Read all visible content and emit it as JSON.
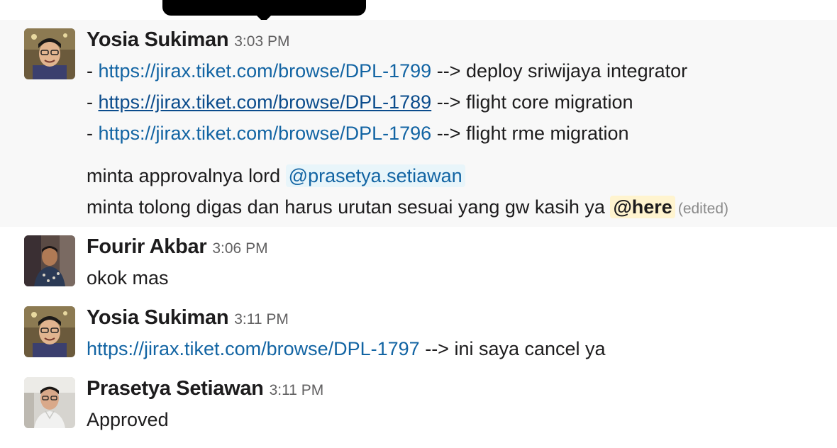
{
  "messages": [
    {
      "author": "Yosia Sukiman",
      "time": "3:03 PM",
      "lines": [
        {
          "prefix": "- ",
          "link": "https://jirax.tiket.com/browse/DPL-1799",
          "suffix": " --> deploy sriwijaya integrator"
        },
        {
          "prefix": "- ",
          "link": "https://jirax.tiket.com/browse/DPL-1789",
          "suffix": " --> flight core migration"
        },
        {
          "prefix": "- ",
          "link": "https://jirax.tiket.com/browse/DPL-1796",
          "suffix": " --> flight rme migration"
        }
      ],
      "approval_text": "minta approvalnya lord ",
      "approval_mention": "@prasetya.setiawan",
      "urge_text": "minta tolong digas dan harus urutan sesuai yang gw kasih ya ",
      "here_mention": "@here",
      "edited_label": "(edited)"
    },
    {
      "author": "Fourir Akbar",
      "time": "3:06 PM",
      "text": "okok mas"
    },
    {
      "author": "Yosia Sukiman",
      "time": "3:11 PM",
      "link": "https://jirax.tiket.com/browse/DPL-1797",
      "suffix": " --> ini saya cancel ya"
    },
    {
      "author": "Prasetya Setiawan",
      "time": "3:11 PM",
      "text": "Approved"
    }
  ],
  "colors": {
    "link": "#1264a3",
    "mention_bg": "#e8f5fa",
    "here_bg": "#fff4cf",
    "hover_bg": "#f8f8f8"
  }
}
